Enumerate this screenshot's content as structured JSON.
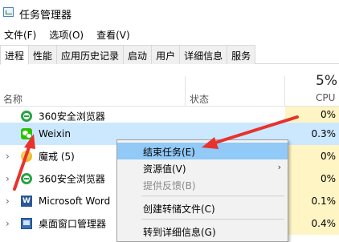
{
  "window": {
    "title": "任务管理器"
  },
  "menubar": {
    "items": [
      "文件(F)",
      "选项(O)",
      "查看(V)"
    ]
  },
  "tabs": [
    "进程",
    "性能",
    "应用历史记录",
    "启动",
    "用户",
    "详细信息",
    "服务"
  ],
  "table": {
    "columns": {
      "name": "名称",
      "status": "状态",
      "cpu_label": "CPU",
      "cpu_total": "5%"
    },
    "rows": [
      {
        "name": "360安全浏览器",
        "cpu": "0%",
        "icon": "ie-browser-icon"
      },
      {
        "name": "Weixin",
        "cpu": "0.3%",
        "icon": "wechat-icon"
      },
      {
        "name": "魔戒 (5)",
        "cpu": "0%",
        "icon": "game-icon"
      },
      {
        "name": "360安全浏览器",
        "cpu": "0%",
        "icon": "ie-browser-icon"
      },
      {
        "name": "Microsoft Word",
        "cpu": "0.1%",
        "icon": "word-icon"
      },
      {
        "name": "桌面窗口管理器",
        "cpu": "0.4%",
        "icon": "desktop-window-icon"
      }
    ]
  },
  "context_menu": {
    "items": [
      "结束任务(E)",
      "资源值(V)",
      "提供反馈(B)",
      "创建转储文件(C)",
      "转到详细信息(G)"
    ]
  },
  "colors": {
    "selected_row": "#cce8ff",
    "cpu_heat": "#fff4c4",
    "menu_highlight": "#91c9f7",
    "annotation_arrow": "#e8322d"
  }
}
